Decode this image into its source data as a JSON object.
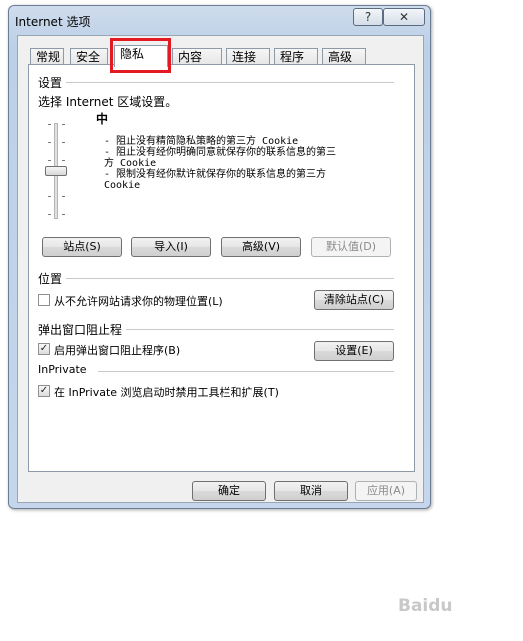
{
  "window": {
    "title": "Internet 选项",
    "help_label": "?",
    "close_label": "✕"
  },
  "tabs": [
    {
      "label": "常规"
    },
    {
      "label": "安全"
    },
    {
      "label": "隐私",
      "active": true
    },
    {
      "label": "内容"
    },
    {
      "label": "连接"
    },
    {
      "label": "程序"
    },
    {
      "label": "高级"
    }
  ],
  "settings": {
    "heading": "设置",
    "instruction": "选择 Internet 区域设置。",
    "level": "中",
    "level_value": 0.5,
    "description": "- 阻止没有精简隐私策略的第三方 Cookie\n- 阻止没有经你明确同意就保存你的联系信息的第三\n方 Cookie\n- 限制没有经你默许就保存你的联系信息的第三方\nCookie",
    "buttons": {
      "sites": "站点(S)",
      "import": "导入(I)",
      "advanced": "高级(V)",
      "default": "默认值(D)"
    }
  },
  "location": {
    "heading": "位置",
    "checkbox_label": "从不允许网站请求你的物理位置(L)",
    "checked": false,
    "clear_button": "清除站点(C)"
  },
  "popup": {
    "heading": "弹出窗口阻止程",
    "checkbox_label": "启用弹出窗口阻止程序(B)",
    "checked": true,
    "settings_button": "设置(E)"
  },
  "inprivate": {
    "heading": "InPrivate",
    "checkbox_label": "在 InPrivate 浏览启动时禁用工具栏和扩展(T)",
    "checked": true
  },
  "footer": {
    "ok": "确定",
    "cancel": "取消",
    "apply": "应用(A)"
  },
  "watermark": "Baidu"
}
